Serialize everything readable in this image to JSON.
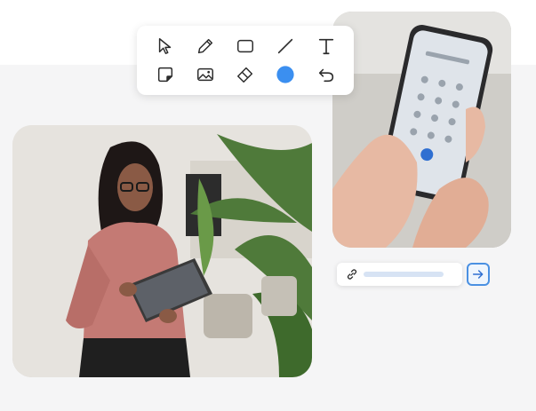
{
  "toolbar": {
    "tools": [
      {
        "name": "select-tool",
        "icon": "cursor-arrow-icon"
      },
      {
        "name": "pencil-tool",
        "icon": "pencil-icon"
      },
      {
        "name": "rectangle-tool",
        "icon": "rectangle-icon"
      },
      {
        "name": "line-tool",
        "icon": "line-icon"
      },
      {
        "name": "text-tool",
        "icon": "text-t-icon"
      },
      {
        "name": "sticky-note-tool",
        "icon": "sticky-note-icon"
      },
      {
        "name": "image-tool",
        "icon": "image-icon"
      },
      {
        "name": "eraser-tool",
        "icon": "eraser-icon"
      },
      {
        "name": "color-picker",
        "icon": "color-circle-icon"
      },
      {
        "name": "undo-tool",
        "icon": "undo-icon"
      }
    ],
    "active_color": "#3b8ff0"
  },
  "url_bar": {
    "icon": "link-icon"
  },
  "go_button": {
    "icon": "arrow-right-icon",
    "accent": "#4a90e2"
  }
}
